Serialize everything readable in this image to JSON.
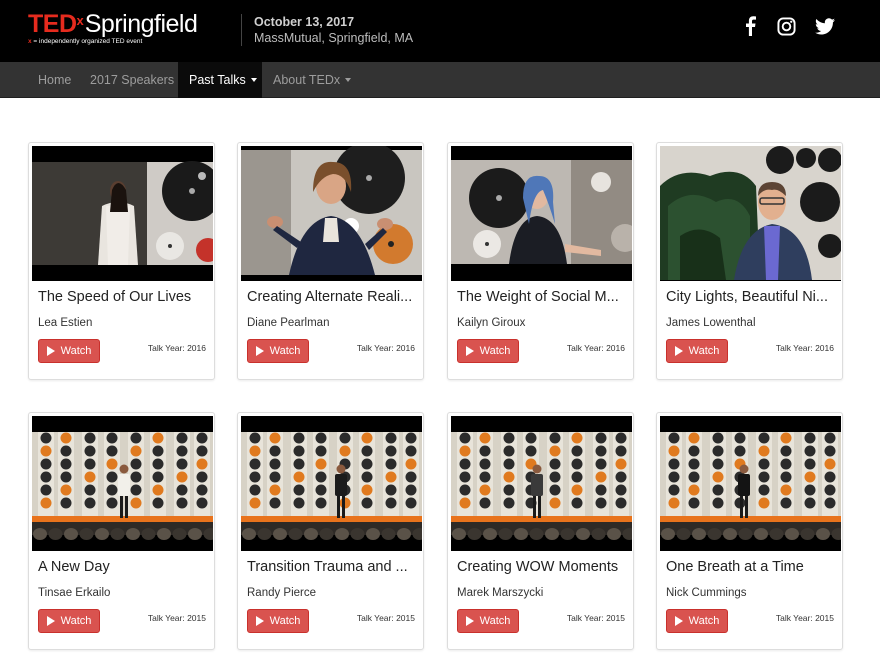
{
  "header": {
    "logo_ted": "TED",
    "logo_x": "x",
    "logo_city": "Springfield",
    "logo_tagline_x": "x",
    "logo_tagline": " = independently organized TED event",
    "event_date": "October 13, 2017",
    "event_location": "MassMutual, Springfield, MA",
    "social_icons": [
      "facebook-icon",
      "instagram-icon",
      "twitter-icon"
    ]
  },
  "nav": {
    "items": [
      {
        "label": "Home",
        "active": false,
        "dropdown": false
      },
      {
        "label": "2017 Speakers",
        "active": false,
        "dropdown": false
      },
      {
        "label": "Past Talks",
        "active": true,
        "dropdown": true
      },
      {
        "label": "About TEDx",
        "active": false,
        "dropdown": true
      }
    ]
  },
  "talks": [
    {
      "title": "The Speed of Our Lives",
      "speaker": "Lea Estien",
      "year": "Talk Year: 2016",
      "button": "Watch"
    },
    {
      "title": "Creating Alternate Reali...",
      "speaker": "Diane Pearlman",
      "year": "Talk Year: 2016",
      "button": "Watch"
    },
    {
      "title": "The Weight of Social M...",
      "speaker": "Kailyn Giroux",
      "year": "Talk Year: 2016",
      "button": "Watch"
    },
    {
      "title": "City Lights, Beautiful Ni...",
      "speaker": "James Lowenthal",
      "year": "Talk Year: 2016",
      "button": "Watch"
    },
    {
      "title": "A New Day",
      "speaker": "Tinsae Erkailo",
      "year": "Talk Year: 2015",
      "button": "Watch"
    },
    {
      "title": "Transition Trauma and ...",
      "speaker": "Randy Pierce",
      "year": "Talk Year: 2015",
      "button": "Watch"
    },
    {
      "title": "Creating WOW Moments",
      "speaker": "Marek Marszycki",
      "year": "Talk Year: 2015",
      "button": "Watch"
    },
    {
      "title": "One Breath at a Time",
      "speaker": "Nick Cummings",
      "year": "Talk Year: 2015",
      "button": "Watch"
    }
  ],
  "colors": {
    "brand_red": "#e62b1e",
    "watch_button": "#d9534f",
    "navbar": "#333333",
    "topbar": "#000000"
  }
}
